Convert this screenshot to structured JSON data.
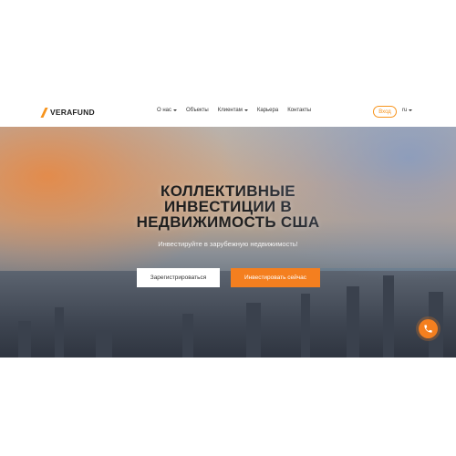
{
  "header": {
    "logo_text": "VERAFUND",
    "nav": [
      {
        "label": "О нас",
        "dropdown": true
      },
      {
        "label": "Объекты",
        "dropdown": false
      },
      {
        "label": "Клиентам",
        "dropdown": true
      },
      {
        "label": "Карьера",
        "dropdown": false
      },
      {
        "label": "Контакты",
        "dropdown": false
      }
    ],
    "login_label": "Вход",
    "language": "ru"
  },
  "hero": {
    "title_lines": [
      "КОЛЛЕКТИВНЫЕ",
      "ИНВЕСТИЦИИ В",
      "НЕДВИЖИМОСТЬ США"
    ],
    "subtitle": "Инвестируйте в зарубежную недвижимость!",
    "register_label": "Зарегистрироваться",
    "invest_label": "Инвестировать сейчас"
  },
  "colors": {
    "accent": "#f47f1f",
    "logo_accent": "#f7941d",
    "text_dark": "#1f1f1f"
  },
  "icons": {
    "phone": "phone-icon",
    "logo": "logo-icon"
  }
}
